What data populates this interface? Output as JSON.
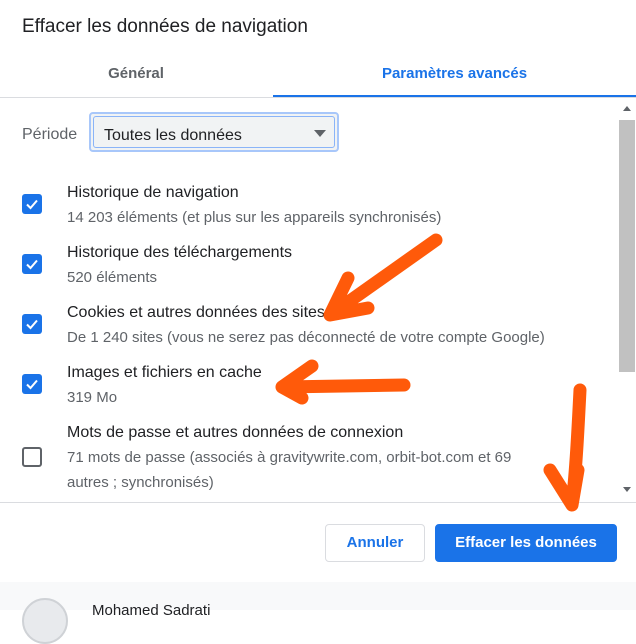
{
  "dialog": {
    "title": "Effacer les données de navigation"
  },
  "tabs": [
    {
      "label": "Général",
      "active": false
    },
    {
      "label": "Paramètres avancés",
      "active": true
    }
  ],
  "period": {
    "label": "Période",
    "value": "Toutes les données"
  },
  "items": [
    {
      "title": "Historique de navigation",
      "sub": "14 203 éléments (et plus sur les appareils synchronisés)",
      "checked": true
    },
    {
      "title": "Historique des téléchargements",
      "sub": "520 éléments",
      "checked": true
    },
    {
      "title": "Cookies et autres données des sites",
      "sub": "De 1 240 sites (vous ne serez pas déconnecté de votre compte Google)",
      "checked": true
    },
    {
      "title": "Images et fichiers en cache",
      "sub": "319 Mo",
      "checked": true
    },
    {
      "title": "Mots de passe et autres données de connexion",
      "sub": "71 mots de passe (associés à gravitywrite.com, orbit-bot.com et 69 autres ; synchronisés)",
      "checked": false
    }
  ],
  "buttons": {
    "cancel": "Annuler",
    "clear": "Effacer les données"
  },
  "account": {
    "name": "Mohamed Sadrati"
  },
  "colors": {
    "accent": "#1a73e8",
    "annotation": "#ff5a0a"
  }
}
